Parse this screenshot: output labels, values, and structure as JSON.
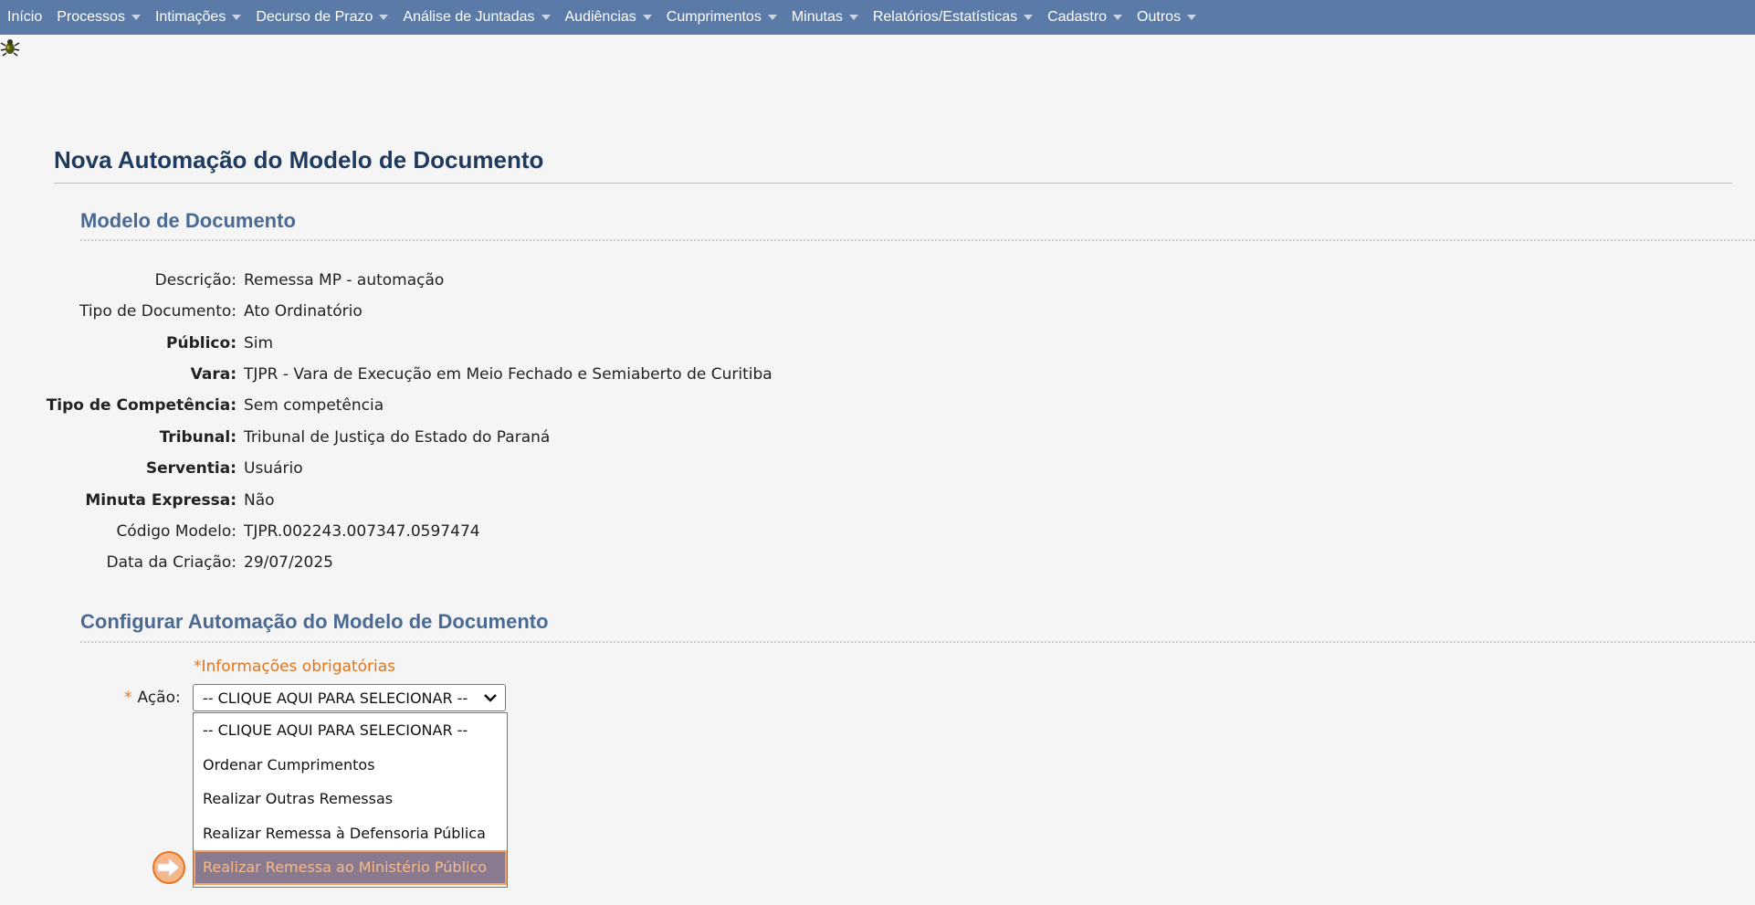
{
  "nav": {
    "items": [
      {
        "label": "Início",
        "has_caret": false
      },
      {
        "label": "Processos",
        "has_caret": true
      },
      {
        "label": "Intimações",
        "has_caret": true
      },
      {
        "label": "Decurso de Prazo",
        "has_caret": true
      },
      {
        "label": "Análise de Juntadas",
        "has_caret": true
      },
      {
        "label": "Audiências",
        "has_caret": true
      },
      {
        "label": "Cumprimentos",
        "has_caret": true
      },
      {
        "label": "Minutas",
        "has_caret": true
      },
      {
        "label": "Relatórios/Estatísticas",
        "has_caret": true
      },
      {
        "label": "Cadastro",
        "has_caret": true
      },
      {
        "label": "Outros",
        "has_caret": true
      }
    ]
  },
  "page": {
    "title": "Nova Automação do Modelo de Documento"
  },
  "model_section": {
    "title": "Modelo de Documento",
    "fields": [
      {
        "label": "Descrição:",
        "value": "Remessa MP - automação",
        "bold": false
      },
      {
        "label": "Tipo de Documento:",
        "value": "Ato Ordinatório",
        "bold": false
      },
      {
        "label": "Público:",
        "value": "Sim",
        "bold": true
      },
      {
        "label": "Vara:",
        "value": "TJPR - Vara de Execução em Meio Fechado e Semiaberto de Curitiba",
        "bold": true
      },
      {
        "label": "Tipo de Competência:",
        "value": "Sem competência",
        "bold": true
      },
      {
        "label": "Tribunal:",
        "value": "Tribunal de Justiça do Estado do Paraná",
        "bold": true
      },
      {
        "label": "Serventia:",
        "value": "Usuário",
        "bold": true
      },
      {
        "label": "Minuta Expressa:",
        "value": "Não",
        "bold": true
      },
      {
        "label": "Código Modelo:",
        "value": "TJPR.002243.007347.0597474",
        "bold": false
      },
      {
        "label": "Data da Criação:",
        "value": "29/07/2025",
        "bold": false
      }
    ]
  },
  "config_section": {
    "title": "Configurar Automação do Modelo de Documento",
    "required_note": "*Informações obrigatórias",
    "acao_star": "*",
    "acao_label": "Ação:",
    "select_value": "-- CLIQUE AQUI PARA SELECIONAR --",
    "options": [
      "-- CLIQUE AQUI PARA SELECIONAR --",
      "Ordenar Cumprimentos",
      "Realizar Outras Remessas",
      "Realizar Remessa à Defensoria Pública",
      "Realizar Remessa ao Ministério Público"
    ],
    "highlighted_option_index": 4
  },
  "colors": {
    "nav_bg": "#5a7aa8",
    "title": "#1f3a5f",
    "section_title": "#4a6a94",
    "required": "#e8731a",
    "highlight_bg": "#8a7a8f",
    "highlight_text": "#f6b98a"
  },
  "icons": {
    "top_left": "bug-icon",
    "pointer": "arrow-right-icon",
    "select": "chevron-down-icon",
    "nav_caret": "caret-down-icon"
  }
}
